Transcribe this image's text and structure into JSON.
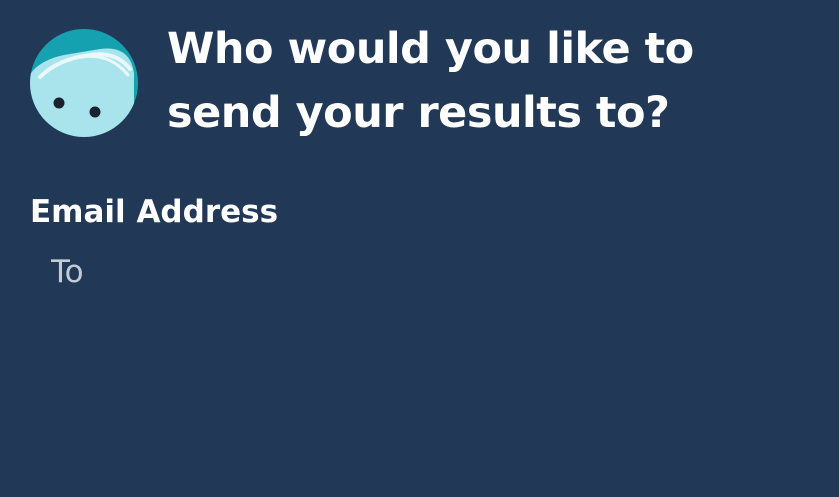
{
  "header": {
    "avatar_icon": "friendly-blob-mascot-icon",
    "title_line_1": "Who would you like to",
    "title_line_2": "send your results to?"
  },
  "form": {
    "email_label": "Email Address",
    "email_placeholder": "To",
    "email_value": ""
  },
  "colors": {
    "background": "#213957",
    "text": "#ffffff",
    "placeholder": "#c3cbd6",
    "avatar_ring": "#16a1b0",
    "avatar_face": "#a9e3eb"
  }
}
